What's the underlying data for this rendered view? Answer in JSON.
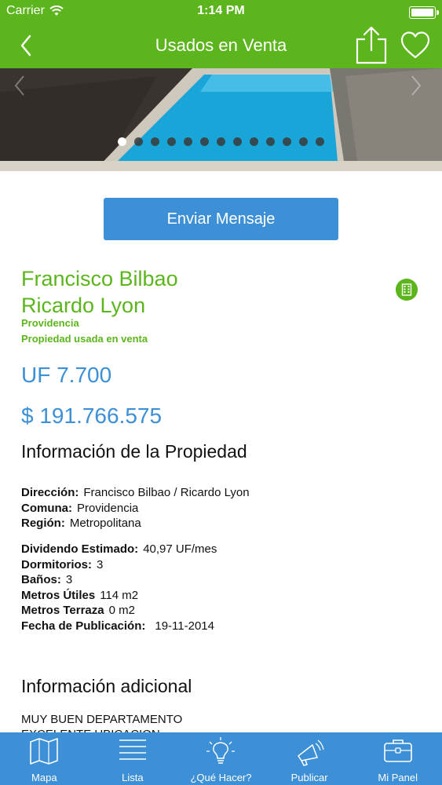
{
  "status_bar": {
    "carrier": "Carrier",
    "time": "1:14 PM"
  },
  "nav": {
    "title": "Usados en Venta"
  },
  "gallery": {
    "photo_count": 13,
    "current_index": 1
  },
  "actions": {
    "send_message": "Enviar Mensaje"
  },
  "property": {
    "address_line1": "Francisco Bilbao",
    "address_line2": "Ricardo Lyon",
    "comuna": "Providencia",
    "type": "Propiedad usada en venta",
    "price_uf": "UF 7.700",
    "price_clp": "$ 191.766.575"
  },
  "info": {
    "title": "Información de la Propiedad",
    "location": [
      {
        "label": "Dirección:",
        "value": "Francisco Bilbao / Ricardo Lyon"
      },
      {
        "label": "Comuna:",
        "value": "Providencia"
      },
      {
        "label": "Región:",
        "value": "Metropolitana"
      }
    ],
    "details": [
      {
        "label": "Dividendo Estimado:",
        "value": "40,97 UF/mes"
      },
      {
        "label": "Dormitorios:",
        "value": "3"
      },
      {
        "label": "Baños:",
        "value": "3"
      },
      {
        "label": "Metros Útiles",
        "value": "114 m2"
      },
      {
        "label": "Metros Terraza",
        "value": "0 m2"
      },
      {
        "label": "Fecha de Publicación:",
        "value": "19-11-2014"
      }
    ]
  },
  "additional": {
    "title": "Información adicional",
    "line1": "MUY BUEN DEPARTAMENTO",
    "line2": "EXCELENTE UBICACION"
  },
  "tabs": [
    {
      "label": "Mapa",
      "icon": "map-icon"
    },
    {
      "label": "Lista",
      "icon": "list-icon"
    },
    {
      "label": "¿Qué Hacer?",
      "icon": "lightbulb-icon"
    },
    {
      "label": "Publicar",
      "icon": "megaphone-icon"
    },
    {
      "label": "Mi Panel",
      "icon": "briefcase-icon"
    }
  ],
  "colors": {
    "brand_green": "#5cb51c",
    "accent_blue": "#3d8fd6"
  }
}
